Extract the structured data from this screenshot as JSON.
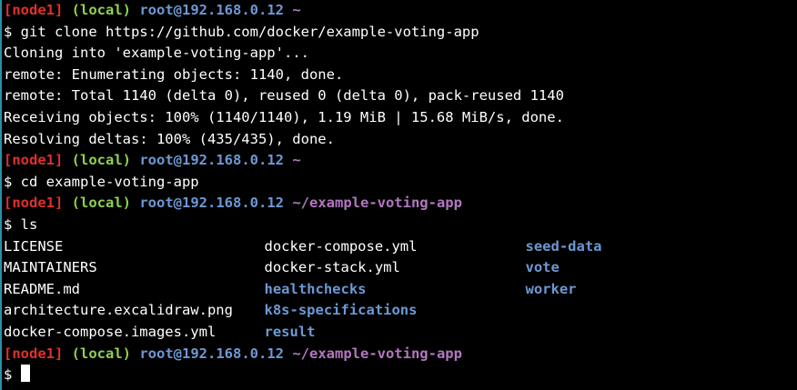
{
  "prompts": [
    {
      "node": "[node1]",
      "local": "(local)",
      "host": "root@192.168.0.12",
      "path": "~"
    },
    {
      "node": "[node1]",
      "local": "(local)",
      "host": "root@192.168.0.12",
      "path": "~"
    },
    {
      "node": "[node1]",
      "local": "(local)",
      "host": "root@192.168.0.12",
      "path": "~/example-voting-app"
    },
    {
      "node": "[node1]",
      "local": "(local)",
      "host": "root@192.168.0.12",
      "path": "~/example-voting-app"
    }
  ],
  "commands": [
    "$ git clone https://github.com/docker/example-voting-app",
    "$ cd example-voting-app",
    "$ ls",
    "$ "
  ],
  "clone_output": [
    "Cloning into 'example-voting-app'...",
    "remote: Enumerating objects: 1140, done.",
    "remote: Total 1140 (delta 0), reused 0 (delta 0), pack-reused 1140",
    "Receiving objects: 100% (1140/1140), 1.19 MiB | 15.68 MiB/s, done.",
    "Resolving deltas: 100% (435/435), done."
  ],
  "ls_output": [
    [
      {
        "name": "LICENSE",
        "type": "file"
      },
      {
        "name": "docker-compose.yml",
        "type": "file"
      },
      {
        "name": "seed-data",
        "type": "dir"
      }
    ],
    [
      {
        "name": "MAINTAINERS",
        "type": "file"
      },
      {
        "name": "docker-stack.yml",
        "type": "file"
      },
      {
        "name": "vote",
        "type": "dir"
      }
    ],
    [
      {
        "name": "README.md",
        "type": "file"
      },
      {
        "name": "healthchecks",
        "type": "dir"
      },
      {
        "name": "worker",
        "type": "dir"
      }
    ],
    [
      {
        "name": "architecture.excalidraw.png",
        "type": "file"
      },
      {
        "name": "k8s-specifications",
        "type": "dir"
      },
      {
        "name": "",
        "type": "file"
      }
    ],
    [
      {
        "name": "docker-compose.images.yml",
        "type": "file"
      },
      {
        "name": "result",
        "type": "dir"
      },
      {
        "name": "",
        "type": "file"
      }
    ]
  ],
  "colors": {
    "background": "#000000",
    "node": "#e0302b",
    "local": "#8fd14f",
    "host": "#6d98d4",
    "path": "#b277c0",
    "directory": "#6d98d4",
    "text": "#ffffff",
    "left_border": "#2a8fa8"
  },
  "icons": {
    "cursor": "block-cursor-icon"
  }
}
